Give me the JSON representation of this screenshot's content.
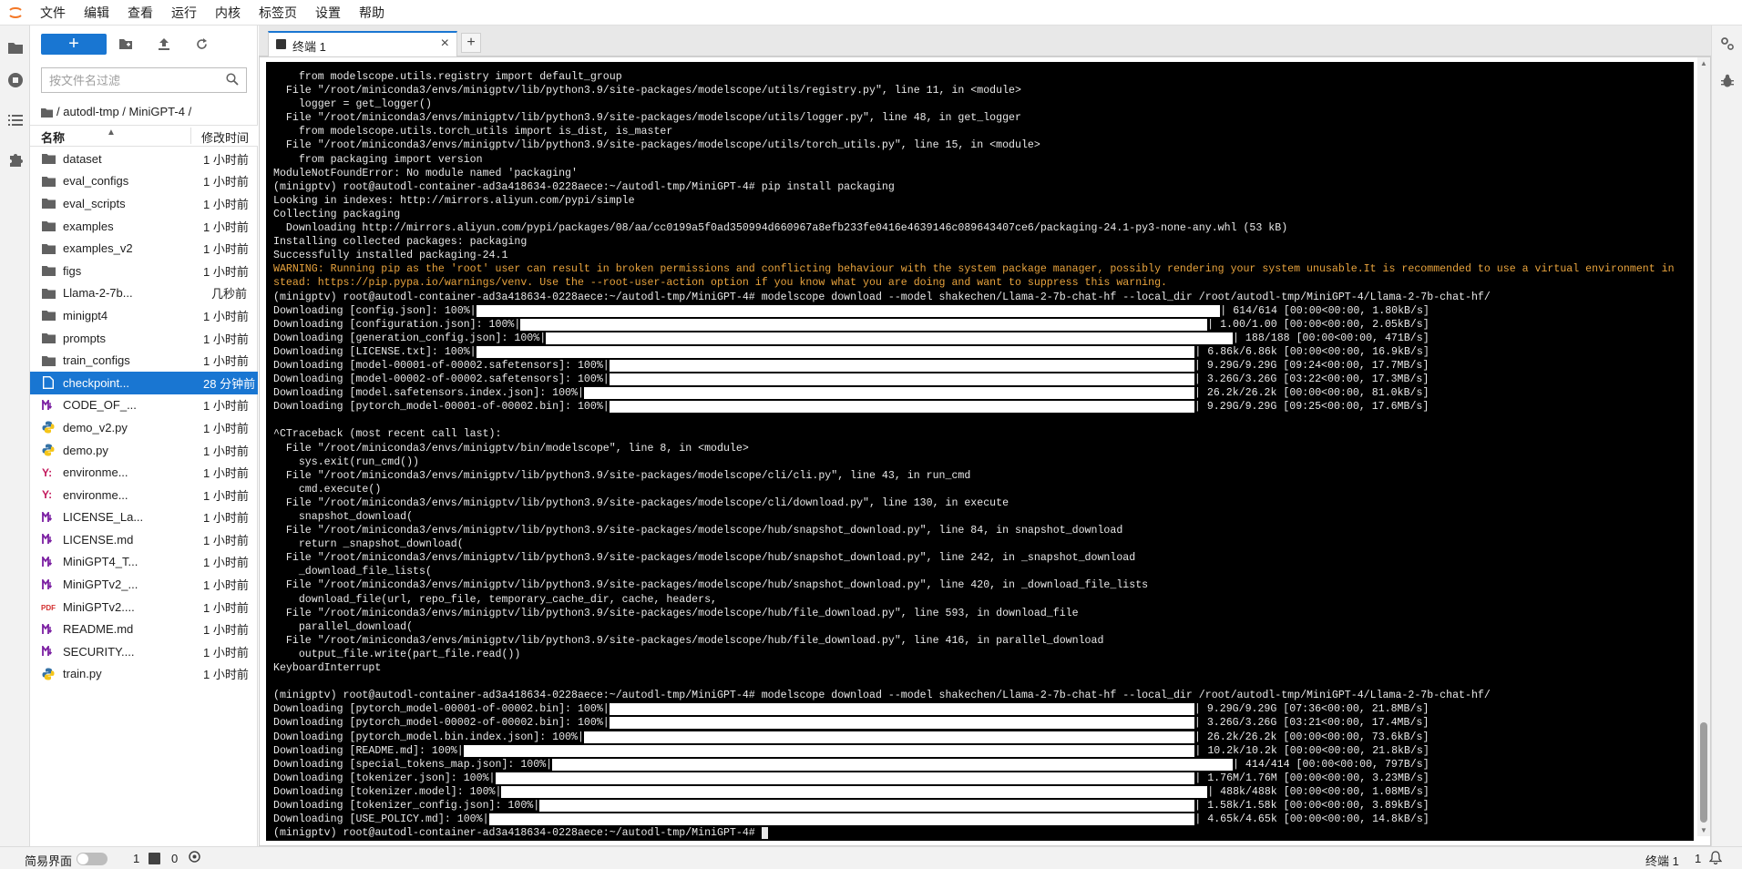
{
  "menu": {
    "items": [
      "文件",
      "编辑",
      "查看",
      "运行",
      "内核",
      "标签页",
      "设置",
      "帮助"
    ]
  },
  "file_browser": {
    "new_label": "+",
    "filter_placeholder": "按文件名过滤",
    "breadcrumb": [
      "/",
      "autodl-tmp",
      "/",
      "MiniGPT-4",
      "/"
    ],
    "col_name": "名称",
    "col_modified": "修改时间",
    "files": [
      {
        "name": "dataset",
        "time": "1 小时前",
        "icon": "folder-icon"
      },
      {
        "name": "eval_configs",
        "time": "1 小时前",
        "icon": "folder-icon"
      },
      {
        "name": "eval_scripts",
        "time": "1 小时前",
        "icon": "folder-icon"
      },
      {
        "name": "examples",
        "time": "1 小时前",
        "icon": "folder-icon"
      },
      {
        "name": "examples_v2",
        "time": "1 小时前",
        "icon": "folder-icon"
      },
      {
        "name": "figs",
        "time": "1 小时前",
        "icon": "folder-icon"
      },
      {
        "name": "Llama-2-7b...",
        "time": "几秒前",
        "icon": "folder-icon"
      },
      {
        "name": "minigpt4",
        "time": "1 小时前",
        "icon": "folder-icon"
      },
      {
        "name": "prompts",
        "time": "1 小时前",
        "icon": "folder-icon"
      },
      {
        "name": "train_configs",
        "time": "1 小时前",
        "icon": "folder-icon"
      },
      {
        "name": "checkpoint...",
        "time": "28 分钟前",
        "icon": "file-icon",
        "selected": true
      },
      {
        "name": "CODE_OF_...",
        "time": "1 小时前",
        "icon": "markdown-icon"
      },
      {
        "name": "demo_v2.py",
        "time": "1 小时前",
        "icon": "python-icon"
      },
      {
        "name": "demo.py",
        "time": "1 小时前",
        "icon": "python-icon"
      },
      {
        "name": "environme...",
        "time": "1 小时前",
        "icon": "yaml-icon"
      },
      {
        "name": "environme...",
        "time": "1 小时前",
        "icon": "yaml-icon"
      },
      {
        "name": "LICENSE_La...",
        "time": "1 小时前",
        "icon": "markdown-icon"
      },
      {
        "name": "LICENSE.md",
        "time": "1 小时前",
        "icon": "markdown-icon"
      },
      {
        "name": "MiniGPT4_T...",
        "time": "1 小时前",
        "icon": "markdown-icon"
      },
      {
        "name": "MiniGPTv2_...",
        "time": "1 小时前",
        "icon": "markdown-icon"
      },
      {
        "name": "MiniGPTv2....",
        "time": "1 小时前",
        "icon": "pdf-icon"
      },
      {
        "name": "README.md",
        "time": "1 小时前",
        "icon": "markdown-icon"
      },
      {
        "name": "SECURITY....",
        "time": "1 小时前",
        "icon": "markdown-icon"
      },
      {
        "name": "train.py",
        "time": "1 小时前",
        "icon": "python-icon"
      }
    ]
  },
  "tabs": [
    {
      "label": "终端 1",
      "close": "×"
    }
  ],
  "tab_add": "+",
  "terminal": {
    "lines": [
      {
        "text": "    from modelscope.utils.registry import default_group"
      },
      {
        "text": "  File \"/root/miniconda3/envs/minigptv/lib/python3.9/site-packages/modelscope/utils/registry.py\", line 11, in <module>"
      },
      {
        "text": "    logger = get_logger()"
      },
      {
        "text": "  File \"/root/miniconda3/envs/minigptv/lib/python3.9/site-packages/modelscope/utils/logger.py\", line 48, in get_logger"
      },
      {
        "text": "    from modelscope.utils.torch_utils import is_dist, is_master"
      },
      {
        "text": "  File \"/root/miniconda3/envs/minigptv/lib/python3.9/site-packages/modelscope/utils/torch_utils.py\", line 15, in <module>"
      },
      {
        "text": "    from packaging import version"
      },
      {
        "text": "ModuleNotFoundError: No module named 'packaging'"
      },
      {
        "text": "(minigptv) root@autodl-container-ad3a418634-0228aece:~/autodl-tmp/MiniGPT-4# pip install packaging"
      },
      {
        "text": "Looking in indexes: http://mirrors.aliyun.com/pypi/simple"
      },
      {
        "text": "Collecting packaging"
      },
      {
        "text": "  Downloading http://mirrors.aliyun.com/pypi/packages/08/aa/cc0199a5f0ad350994d660967a8efb233fe0416e4639146c089643407ce6/packaging-24.1-py3-none-any.whl (53 kB)"
      },
      {
        "text": "Installing collected packages: packaging"
      },
      {
        "text": "Successfully installed packaging-24.1"
      },
      {
        "text": "WARNING: Running pip as the 'root' user can result in broken permissions and conflicting behaviour with the system package manager, possibly rendering your system unusable.It is recommended to use a virtual environment in",
        "warn": true
      },
      {
        "text": "stead: https://pip.pypa.io/warnings/venv. Use the --root-user-action option if you know what you are doing and want to suppress this warning.",
        "warn": true
      },
      {
        "text": "(minigptv) root@autodl-container-ad3a418634-0228aece:~/autodl-tmp/MiniGPT-4# modelscope download --model shakechen/Llama-2-7b-chat-hf --local_dir /root/autodl-tmp/MiniGPT-4/Llama-2-7b-chat-hf/"
      },
      {
        "pre": "Downloading [config.json]: 100%|",
        "progress": 1.0,
        "post": "| 614/614 [00:00<00:00, 1.80kB/s]"
      },
      {
        "pre": "Downloading [configuration.json]: 100%|",
        "progress": 1.0,
        "post": "| 1.00/1.00 [00:00<00:00, 2.05kB/s]"
      },
      {
        "pre": "Downloading [generation_config.json]: 100%|",
        "progress": 1.0,
        "post": "| 188/188 [00:00<00:00, 471B/s]"
      },
      {
        "pre": "Downloading [LICENSE.txt]: 100%|",
        "progress": 1.0,
        "post": "| 6.86k/6.86k [00:00<00:00, 16.9kB/s]"
      },
      {
        "pre": "Downloading [model-00001-of-00002.safetensors]: 100%|",
        "progress": 1.0,
        "post": "| 9.29G/9.29G [09:24<00:00, 17.7MB/s]"
      },
      {
        "pre": "Downloading [model-00002-of-00002.safetensors]: 100%|",
        "progress": 1.0,
        "post": "| 3.26G/3.26G [03:22<00:00, 17.3MB/s]"
      },
      {
        "pre": "Downloading [model.safetensors.index.json]: 100%|",
        "progress": 1.0,
        "post": "| 26.2k/26.2k [00:00<00:00, 81.0kB/s]"
      },
      {
        "pre": "Downloading [pytorch_model-00001-of-00002.bin]: 100%|",
        "progress": 1.0,
        "post": "| 9.29G/9.29G [09:25<00:00, 17.6MB/s]"
      },
      {
        "text": "",
        "blank": true
      },
      {
        "text": "^CTraceback (most recent call last):"
      },
      {
        "text": "  File \"/root/miniconda3/envs/minigptv/bin/modelscope\", line 8, in <module>"
      },
      {
        "text": "    sys.exit(run_cmd())"
      },
      {
        "text": "  File \"/root/miniconda3/envs/minigptv/lib/python3.9/site-packages/modelscope/cli/cli.py\", line 43, in run_cmd"
      },
      {
        "text": "    cmd.execute()"
      },
      {
        "text": "  File \"/root/miniconda3/envs/minigptv/lib/python3.9/site-packages/modelscope/cli/download.py\", line 130, in execute"
      },
      {
        "text": "    snapshot_download("
      },
      {
        "text": "  File \"/root/miniconda3/envs/minigptv/lib/python3.9/site-packages/modelscope/hub/snapshot_download.py\", line 84, in snapshot_download"
      },
      {
        "text": "    return _snapshot_download("
      },
      {
        "text": "  File \"/root/miniconda3/envs/minigptv/lib/python3.9/site-packages/modelscope/hub/snapshot_download.py\", line 242, in _snapshot_download"
      },
      {
        "text": "    _download_file_lists("
      },
      {
        "text": "  File \"/root/miniconda3/envs/minigptv/lib/python3.9/site-packages/modelscope/hub/snapshot_download.py\", line 420, in _download_file_lists"
      },
      {
        "text": "    download_file(url, repo_file, temporary_cache_dir, cache, headers,"
      },
      {
        "text": "  File \"/root/miniconda3/envs/minigptv/lib/python3.9/site-packages/modelscope/hub/file_download.py\", line 593, in download_file"
      },
      {
        "text": "    parallel_download("
      },
      {
        "text": "  File \"/root/miniconda3/envs/minigptv/lib/python3.9/site-packages/modelscope/hub/file_download.py\", line 416, in parallel_download"
      },
      {
        "text": "    output_file.write(part_file.read())"
      },
      {
        "text": "KeyboardInterrupt"
      },
      {
        "text": "",
        "blank": true
      },
      {
        "text": "(minigptv) root@autodl-container-ad3a418634-0228aece:~/autodl-tmp/MiniGPT-4# modelscope download --model shakechen/Llama-2-7b-chat-hf --local_dir /root/autodl-tmp/MiniGPT-4/Llama-2-7b-chat-hf/"
      },
      {
        "pre": "Downloading [pytorch_model-00001-of-00002.bin]: 100%|",
        "progress": 1.0,
        "post": "| 9.29G/9.29G [07:36<00:00, 21.8MB/s]"
      },
      {
        "pre": "Downloading [pytorch_model-00002-of-00002.bin]: 100%|",
        "progress": 1.0,
        "post": "| 3.26G/3.26G [03:21<00:00, 17.4MB/s]"
      },
      {
        "pre": "Downloading [pytorch_model.bin.index.json]: 100%|",
        "progress": 1.0,
        "post": "| 26.2k/26.2k [00:00<00:00, 73.6kB/s]"
      },
      {
        "pre": "Downloading [README.md]: 100%|",
        "progress": 1.0,
        "post": "| 10.2k/10.2k [00:00<00:00, 21.8kB/s]"
      },
      {
        "pre": "Downloading [special_tokens_map.json]: 100%|",
        "progress": 1.0,
        "post": "| 414/414 [00:00<00:00, 797B/s]"
      },
      {
        "pre": "Downloading [tokenizer.json]: 100%|",
        "progress": 1.0,
        "post": "| 1.76M/1.76M [00:00<00:00, 3.23MB/s]"
      },
      {
        "pre": "Downloading [tokenizer.model]: 100%|",
        "progress": 1.0,
        "post": "| 488k/488k [00:00<00:00, 1.08MB/s]"
      },
      {
        "pre": "Downloading [tokenizer_config.json]: 100%|",
        "progress": 1.0,
        "post": "| 1.58k/1.58k [00:00<00:00, 3.89kB/s]"
      },
      {
        "pre": "Downloading [USE_POLICY.md]: 100%|",
        "progress": 1.0,
        "post": "| 4.65k/4.65k [00:00<00:00, 14.8kB/s]"
      },
      {
        "text": "(minigptv) root@autodl-container-ad3a418634-0228aece:~/autodl-tmp/MiniGPT-4# ",
        "cursor": true
      }
    ]
  },
  "status": {
    "simple_label": "简易界面",
    "n1": "1",
    "n2": "0",
    "mode": "终端 1",
    "n3": "1"
  },
  "colors": {
    "accent": "#1976d2",
    "terminal_bg": "#000000",
    "warning": "#e8a33d"
  }
}
